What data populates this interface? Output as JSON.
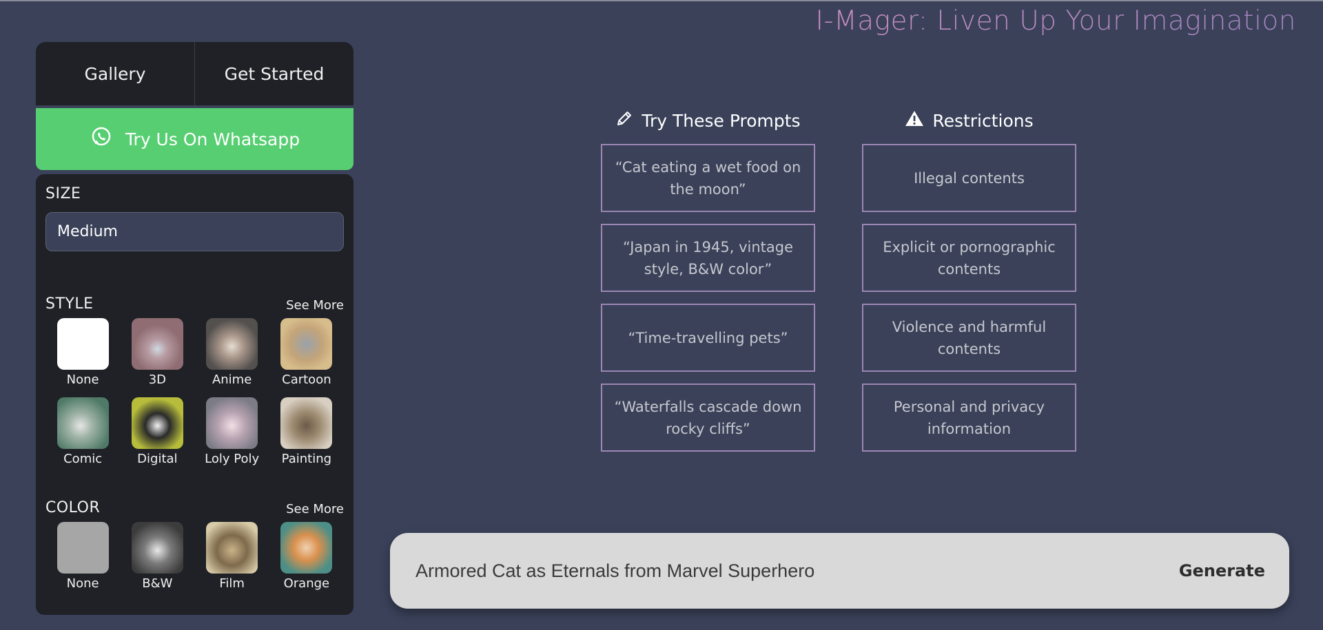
{
  "header": {
    "title": "I-Mager: Liven Up Your Imagination"
  },
  "nav": {
    "tabs": [
      {
        "label": "Gallery"
      },
      {
        "label": "Get Started"
      }
    ]
  },
  "whatsapp": {
    "label": "Try Us On Whatsapp",
    "icon": "whatsapp-icon"
  },
  "size": {
    "label": "SIZE",
    "selected": "Medium"
  },
  "style": {
    "label": "STYLE",
    "see_more": "See More",
    "items": [
      {
        "label": "None"
      },
      {
        "label": "3D"
      },
      {
        "label": "Anime"
      },
      {
        "label": "Cartoon"
      },
      {
        "label": "Comic"
      },
      {
        "label": "Digital"
      },
      {
        "label": "Loly Poly"
      },
      {
        "label": "Painting"
      }
    ]
  },
  "color": {
    "label": "COLOR",
    "see_more": "See More",
    "items": [
      {
        "label": "None"
      },
      {
        "label": "B&W"
      },
      {
        "label": "Film"
      },
      {
        "label": "Orange"
      }
    ]
  },
  "prompts": {
    "title": "Try These Prompts",
    "icon": "pencil-icon",
    "items": [
      "“Cat eating a wet food on the moon”",
      "“Japan in 1945, vintage style, B&W color”",
      "“Time-travelling pets”",
      "“Waterfalls cascade down rocky cliffs”"
    ]
  },
  "restrictions": {
    "title": "Restrictions",
    "icon": "warning-icon",
    "items": [
      "Illegal contents",
      "Explicit or pornographic contents",
      "Violence and harmful contents",
      "Personal and privacy information"
    ]
  },
  "prompt_bar": {
    "value": "Armored Cat as Eternals from Marvel Superhero",
    "generate_label": "Generate"
  }
}
